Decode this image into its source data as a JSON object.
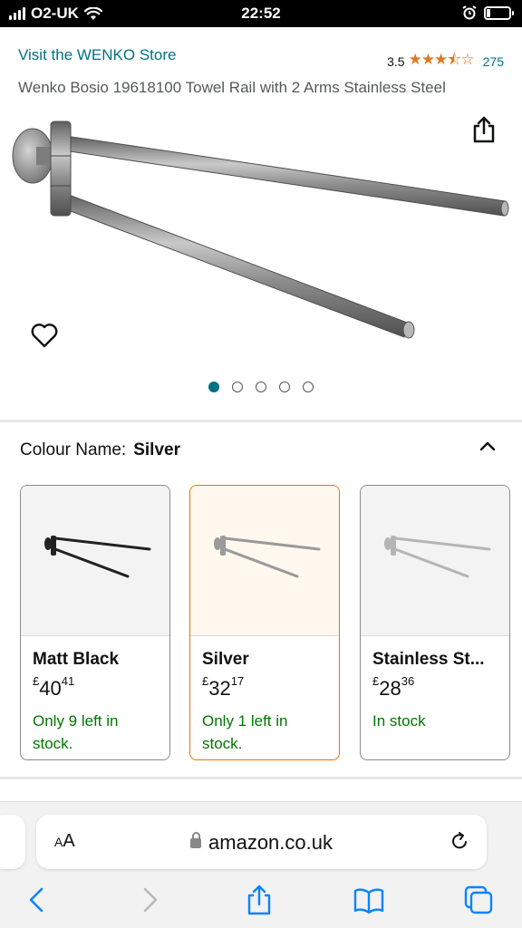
{
  "status": {
    "carrier": "O2-UK",
    "time": "22:52"
  },
  "store": {
    "link": "Visit the WENKO Store"
  },
  "rating": {
    "value": "3.5",
    "stars": "★★★⯪☆",
    "count": "275"
  },
  "product": {
    "title": "Wenko Bosio 19618100 Towel Rail with 2 Arms Stainless Steel"
  },
  "gallery": {
    "images_total": 5,
    "current_image": 1
  },
  "colour": {
    "label": "Colour Name:",
    "value": "Silver"
  },
  "variants": [
    {
      "name": "Matt Black",
      "currency": "£",
      "price_whole": "40",
      "price_fraction": "41",
      "stock": "Only 9 left in stock.",
      "selected": false,
      "color": "#222222"
    },
    {
      "name": "Silver",
      "currency": "£",
      "price_whole": "32",
      "price_fraction": "17",
      "stock": "Only 1 left in stock.",
      "selected": true,
      "color": "#9a9a9a"
    },
    {
      "name": "Stainless St...",
      "currency": "£",
      "price_whole": "28",
      "price_fraction": "36",
      "stock": "In stock",
      "selected": false,
      "color": "#b5b5b5"
    }
  ],
  "browser": {
    "aa": "AA",
    "url": "amazon.co.uk"
  },
  "colors": {
    "link": "#007185",
    "star": "#de7921",
    "in_stock": "#007600",
    "selected_border": "#e77600",
    "browser_icon": "#0a84ff"
  }
}
